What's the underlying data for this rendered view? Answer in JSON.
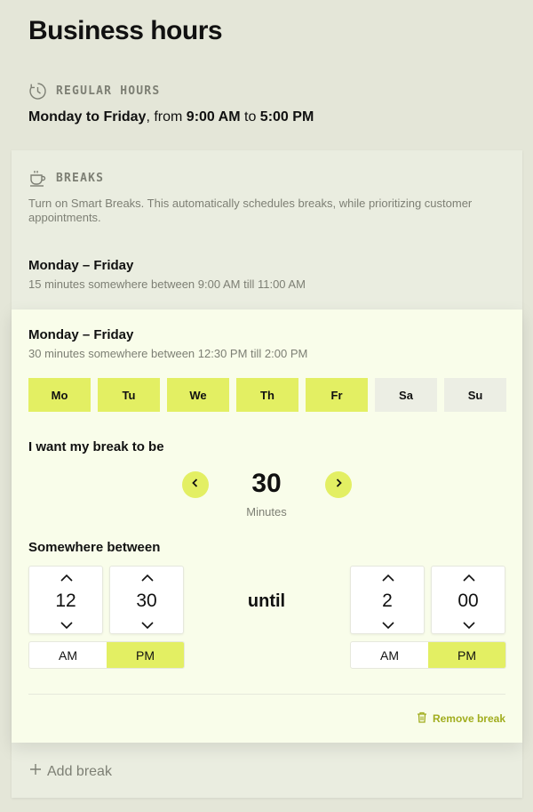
{
  "page": {
    "title": "Business hours"
  },
  "regular_hours": {
    "heading": "REGULAR HOURS",
    "icon": "clock-icon",
    "days": "Monday to Friday",
    "from_text": ", from ",
    "start": "9:00 AM",
    "to_text": " to ",
    "end": "5:00 PM"
  },
  "breaks": {
    "heading": "BREAKS",
    "icon": "coffee-cup-icon",
    "description": "Turn on Smart Breaks. This automatically schedules breaks, while prioritizing customer appointments.",
    "items": [
      {
        "title": "Monday – Friday",
        "summary": "15 minutes somewhere between 9:00 AM till 11:00 AM"
      },
      {
        "title": "Monday – Friday",
        "summary": "30 minutes somewhere between 12:30 PM till 2:00 PM"
      }
    ]
  },
  "editor": {
    "days": [
      {
        "label": "Mo",
        "selected": true
      },
      {
        "label": "Tu",
        "selected": true
      },
      {
        "label": "We",
        "selected": true
      },
      {
        "label": "Th",
        "selected": true
      },
      {
        "label": "Fr",
        "selected": true
      },
      {
        "label": "Sa",
        "selected": false
      },
      {
        "label": "Su",
        "selected": false
      }
    ],
    "duration_label": "I want my break to be",
    "duration_value": "30",
    "duration_unit": "Minutes",
    "window_label": "Somewhere between",
    "start_hour": "12",
    "start_minute": "30",
    "start_am": "AM",
    "start_pm": "PM",
    "start_period": "PM",
    "until_label": "until",
    "end_hour": "2",
    "end_minute": "00",
    "end_am": "AM",
    "end_pm": "PM",
    "end_period": "PM",
    "remove_label": "Remove break"
  },
  "add_break_label": "Add break",
  "colors": {
    "accent": "#e3ef63",
    "background": "#e4e6d8",
    "active_card": "#f9fdea",
    "remove_text": "#a1ad1e"
  }
}
